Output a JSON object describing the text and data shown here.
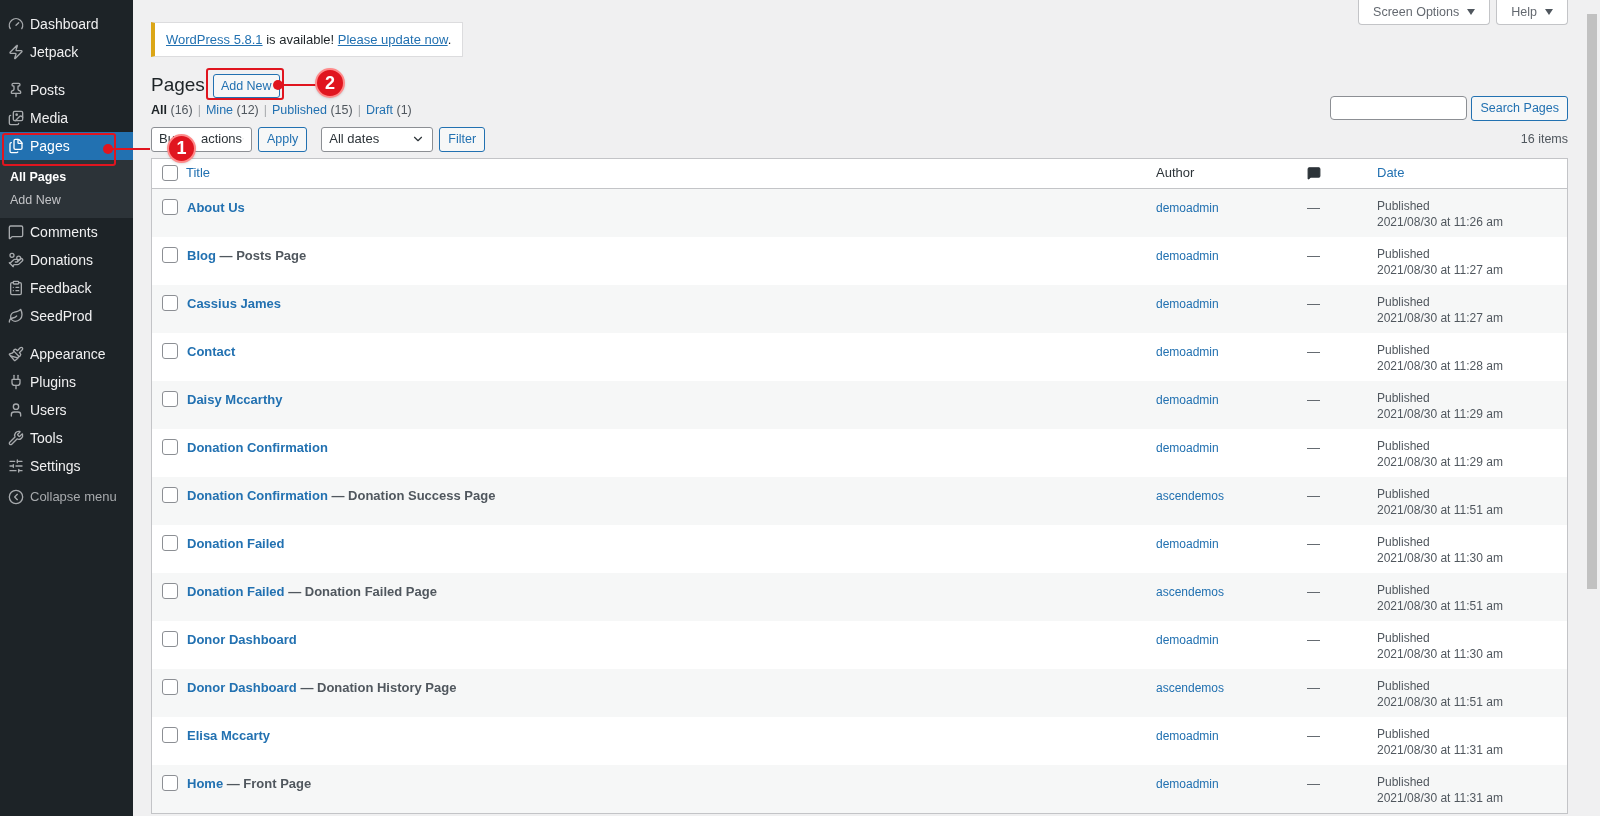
{
  "sidebar": {
    "items": [
      {
        "label": "Dashboard",
        "selected": false
      },
      {
        "label": "Jetpack",
        "selected": false
      },
      {
        "label": "Posts",
        "selected": false
      },
      {
        "label": "Media",
        "selected": false
      },
      {
        "label": "Pages",
        "selected": true,
        "children": [
          {
            "label": "All Pages",
            "selected": true
          },
          {
            "label": "Add New",
            "selected": false
          }
        ]
      },
      {
        "label": "Comments",
        "selected": false
      },
      {
        "label": "Donations",
        "selected": false
      },
      {
        "label": "Feedback",
        "selected": false
      },
      {
        "label": "SeedProd",
        "selected": false
      },
      {
        "label": "Appearance",
        "selected": false
      },
      {
        "label": "Plugins",
        "selected": false
      },
      {
        "label": "Users",
        "selected": false
      },
      {
        "label": "Tools",
        "selected": false
      },
      {
        "label": "Settings",
        "selected": false
      }
    ],
    "collapse_label": "Collapse menu"
  },
  "top_buttons": [
    "Screen Options",
    "Help"
  ],
  "notice": {
    "link": "WordPress 5.8.1",
    "text": " is available! ",
    "action": "Please update now",
    "end": "."
  },
  "heading": "Pages",
  "add_new": "Add New",
  "filter_separator": "|",
  "filters": [
    {
      "label": "All",
      "count": "(16)",
      "selected": true
    },
    {
      "label": "Mine",
      "count": "(12)",
      "selected": false
    },
    {
      "label": "Published",
      "count": "(15)",
      "selected": false
    },
    {
      "label": "Draft",
      "count": "(1)",
      "selected": false
    }
  ],
  "bulk_actions": [
    "Bu",
    "actions"
  ],
  "apply": "Apply",
  "dates": "All dates",
  "filter": "Filter",
  "search": {
    "button": "Search Pages"
  },
  "item_count": "16 items",
  "table": {
    "select_all_checked": false,
    "columns": [
      "Title",
      "Author",
      "Date"
    ],
    "rows": [
      {
        "title": "About Us",
        "author": "demoadmin",
        "comments": "—",
        "status": "Published",
        "date": "2021/08/30 at 11:26 am",
        "checked": false
      },
      {
        "title": "Blog",
        "state": "— Posts Page",
        "author": "demoadmin",
        "comments": "—",
        "status": "Published",
        "date": "2021/08/30 at 11:27 am",
        "checked": false
      },
      {
        "title": "Cassius James",
        "author": "demoadmin",
        "comments": "—",
        "status": "Published",
        "date": "2021/08/30 at 11:27 am",
        "checked": false
      },
      {
        "title": "Contact",
        "author": "demoadmin",
        "comments": "—",
        "status": "Published",
        "date": "2021/08/30 at 11:28 am",
        "checked": false
      },
      {
        "title": "Daisy Mccarthy",
        "author": "demoadmin",
        "comments": "—",
        "status": "Published",
        "date": "2021/08/30 at 11:29 am",
        "checked": false
      },
      {
        "title": "Donation Confirmation",
        "author": "demoadmin",
        "comments": "—",
        "status": "Published",
        "date": "2021/08/30 at 11:29 am",
        "checked": false
      },
      {
        "title": "Donation Confirmation",
        "state": "— Donation Success Page",
        "author": "ascendemos",
        "comments": "—",
        "status": "Published",
        "date": "2021/08/30 at 11:51 am",
        "checked": false
      },
      {
        "title": "Donation Failed",
        "author": "demoadmin",
        "comments": "—",
        "status": "Published",
        "date": "2021/08/30 at 11:30 am",
        "checked": false
      },
      {
        "title": "Donation Failed",
        "state": "— Donation Failed Page",
        "author": "ascendemos",
        "comments": "—",
        "status": "Published",
        "date": "2021/08/30 at 11:51 am",
        "checked": false
      },
      {
        "title": "Donor Dashboard",
        "author": "demoadmin",
        "comments": "—",
        "status": "Published",
        "date": "2021/08/30 at 11:30 am",
        "checked": false
      },
      {
        "title": "Donor Dashboard",
        "state": "— Donation History Page",
        "author": "ascendemos",
        "comments": "—",
        "status": "Published",
        "date": "2021/08/30 at 11:51 am",
        "checked": false
      },
      {
        "title": "Elisa Mccarty",
        "author": "demoadmin",
        "comments": "—",
        "status": "Published",
        "date": "2021/08/30 at 11:31 am",
        "checked": false
      },
      {
        "title": "Home",
        "state": "— Front Page",
        "author": "demoadmin",
        "comments": "—",
        "status": "Published",
        "date": "2021/08/30 at 11:31 am",
        "checked": false
      }
    ]
  },
  "annotations": [
    {
      "label": "1"
    },
    {
      "label": "2"
    }
  ]
}
